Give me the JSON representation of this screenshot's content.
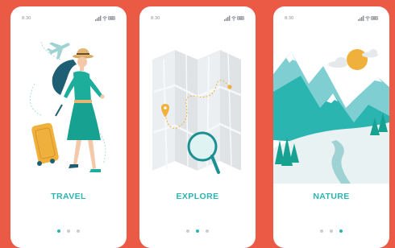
{
  "screens": [
    {
      "id": "travel",
      "title": "TRAVEL",
      "time": "8:30",
      "active_page": 0
    },
    {
      "id": "explore",
      "title": "EXPLORE",
      "time": "8:30",
      "active_page": 1
    },
    {
      "id": "nature",
      "title": "NATURE",
      "time": "8:30",
      "active_page": 2
    }
  ],
  "page_count": 3,
  "colors": {
    "background": "#ea5a45",
    "card": "#ffffff",
    "accent": "#2bb5b0",
    "dot_inactive": "#c9cdd1",
    "map_pin": "#f0b03c"
  },
  "icons": [
    "signal-icon",
    "wifi-icon",
    "battery-icon",
    "airplane-icon",
    "magnifier-icon",
    "map-pin-icon",
    "sun-icon",
    "cloud-icon"
  ]
}
